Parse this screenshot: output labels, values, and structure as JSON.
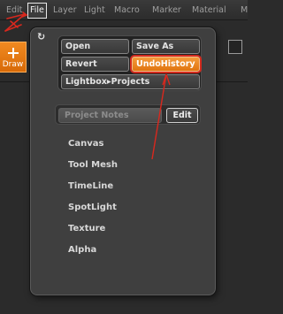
{
  "menubar": {
    "items": [
      "Edit",
      "File",
      "Layer",
      "Light",
      "Macro",
      "Marker",
      "Material",
      "M"
    ],
    "active_index": 1
  },
  "toolbar": {
    "draw_label": "Draw"
  },
  "file_menu": {
    "buttons": {
      "open": "Open",
      "save_as": "Save As",
      "revert": "Revert",
      "undo_history": "UndoHistory",
      "lightbox_projects": "Lightbox▸Projects"
    },
    "project_notes_label": "Project Notes",
    "edit_label": "Edit",
    "subpalettes": [
      "Canvas",
      "Tool Mesh",
      "TimeLine",
      "SpotLight",
      "Texture",
      "Alpha"
    ]
  },
  "colors": {
    "accent_orange": "#e98220",
    "annotation_red": "#d8281e",
    "panel_bg": "#3f3f3f"
  },
  "icons": {
    "refresh": "refresh-icon",
    "draw": "crosshair-icon"
  }
}
